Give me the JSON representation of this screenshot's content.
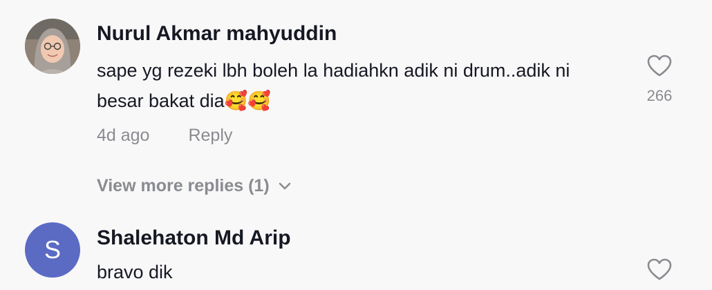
{
  "comments": [
    {
      "username": "Nurul Akmar mahyuddin",
      "text": "sape yg rezeki lbh boleh la hadiahkn adik ni drum..adik ni besar bakat dia🥰🥰",
      "age": "4d ago",
      "reply_label": "Reply",
      "like_count": "266",
      "avatar_type": "photo",
      "more_replies": "View more replies (1)"
    },
    {
      "username": "Shalehaton Md Arip",
      "text": "bravo dik",
      "avatar_letter": "S",
      "avatar_color": "#5b6bc4"
    }
  ],
  "icons": {
    "like": "heart-outline-icon",
    "expand": "chevron-down-icon"
  },
  "colors": {
    "background": "#f8f8f8",
    "text_primary": "#161823",
    "text_secondary": "#8a8b91"
  }
}
